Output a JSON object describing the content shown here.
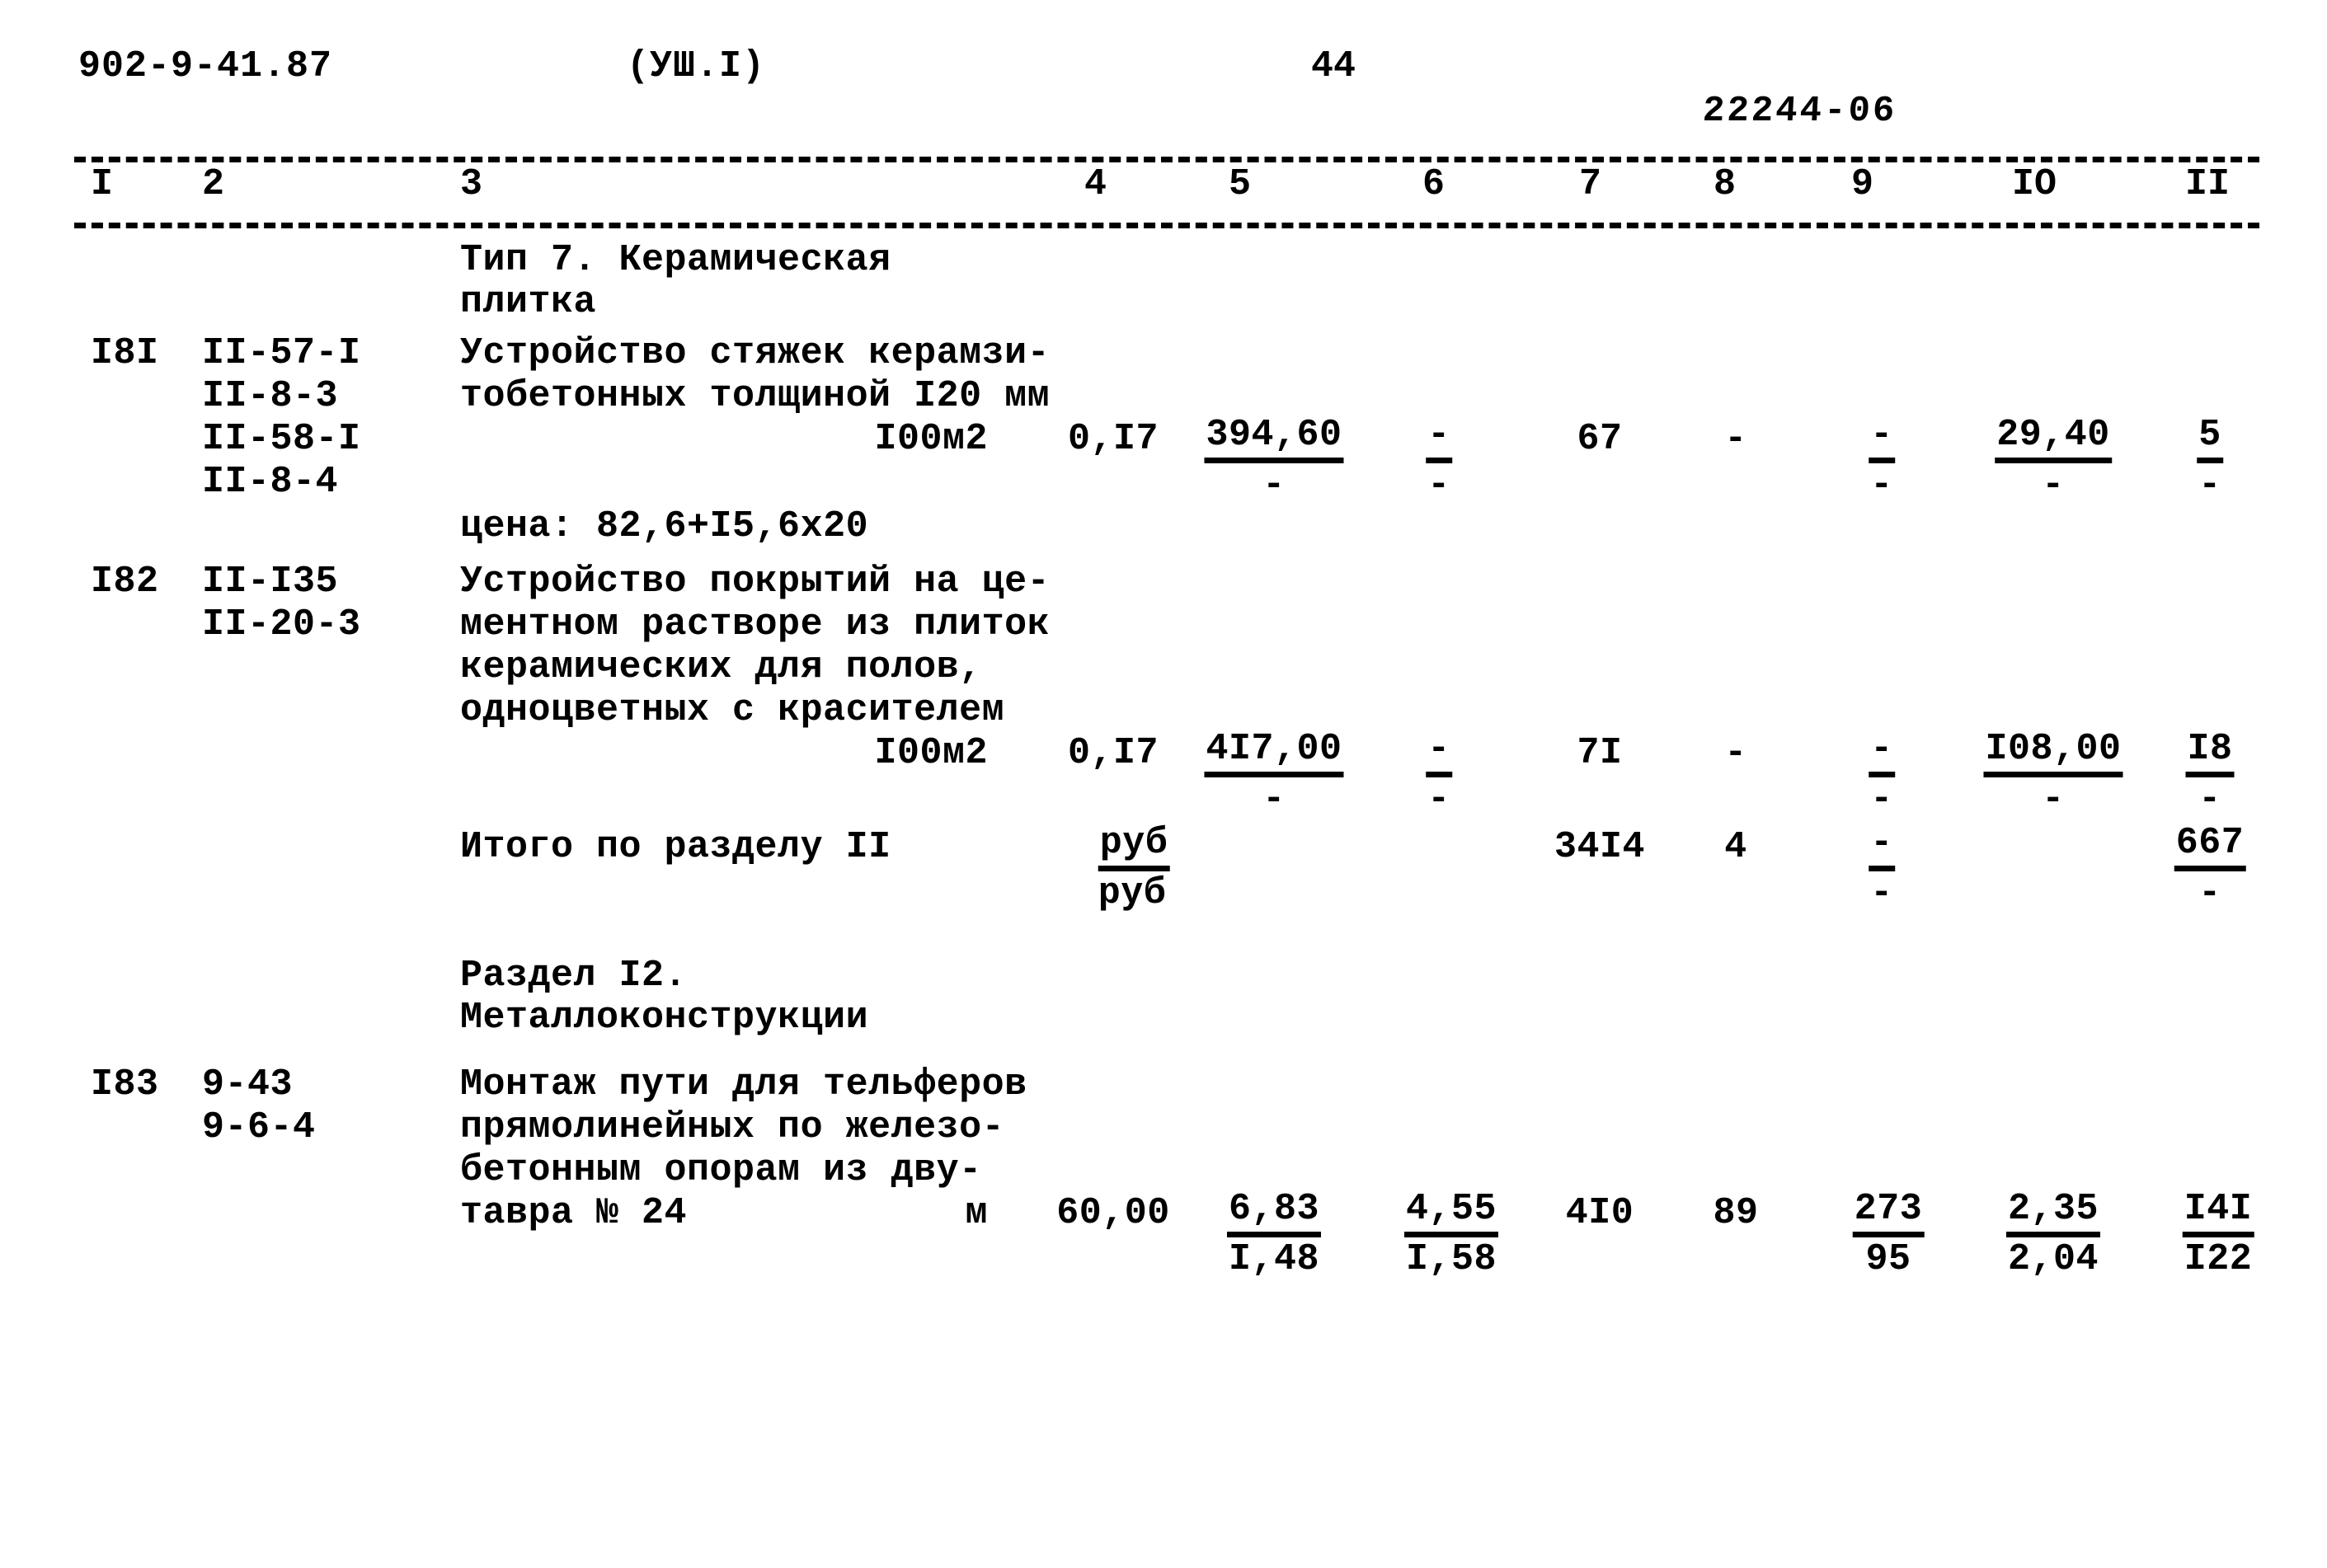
{
  "header": {
    "doc_code": "902-9-41.87",
    "series": "(УШ.I)",
    "page_number": "44",
    "stamp": "22244-06"
  },
  "table": {
    "column_numbers": [
      "I",
      "2",
      "3",
      "4",
      "5",
      "6",
      "7",
      "8",
      "9",
      "IO",
      "II"
    ],
    "rows": [
      {
        "kind": "section_title",
        "title": "Тип 7. Керамическая плитка"
      },
      {
        "kind": "item",
        "num": "I8I",
        "codes": "II-57-I\nII-8-3\nII-58-I\nII-8-4",
        "desc": "Устройство стяжек керамзи-\nтобетонных толщиной I20 мм",
        "unit": "I00м2",
        "note": "цена: 82,6+I5,6x20",
        "c4": "0,I7",
        "c5_num": "394,60",
        "c5_den": "-",
        "c6_num": "-",
        "c6_den": "-",
        "c7": "67",
        "c8": "-",
        "c9_num": "-",
        "c9_den": "-",
        "c10_num": "29,40",
        "c10_den": "-",
        "c11_num": "5",
        "c11_den": "-"
      },
      {
        "kind": "item",
        "num": "I82",
        "codes": "II-I35\nII-20-3",
        "desc": "Устройство покрытий на це-\nментном растворе из плиток\nкерамических для полов,\nодноцветных с красителем",
        "unit": "I00м2",
        "note": "",
        "c4": "0,I7",
        "c5_num": "4I7,00",
        "c5_den": "-",
        "c6_num": "-",
        "c6_den": "-",
        "c7": "7I",
        "c8": "-",
        "c9_num": "-",
        "c9_den": "-",
        "c10_num": "I08,00",
        "c10_den": "-",
        "c11_num": "I8",
        "c11_den": "-"
      },
      {
        "kind": "total",
        "label": "Итого по разделу II",
        "unit_num": "руб",
        "unit_den": "руб",
        "c7": "34I4",
        "c8": "4",
        "c9_num": "-",
        "c9_den": "-",
        "c11_num": "667",
        "c11_den": "-"
      },
      {
        "kind": "section_title",
        "title": "Раздел I2. Металлоконструкции"
      },
      {
        "kind": "item",
        "num": "I83",
        "codes": "9-43\n9-6-4",
        "desc": "Монтаж пути для тельферов\nпрямолинейных по железо-\nбетонным опорам из дву-\nтавра № 24",
        "unit": "м",
        "note": "",
        "c4": "60,00",
        "c5_num": "6,83",
        "c5_den": "I,48",
        "c6_num": "4,55",
        "c6_den": "I,58",
        "c7": "4I0",
        "c8": "89",
        "c9_num": "273",
        "c9_den": "95",
        "c10_num": "2,35",
        "c10_den": "2,04",
        "c11_num": "I4I",
        "c11_den": "I22"
      }
    ]
  }
}
